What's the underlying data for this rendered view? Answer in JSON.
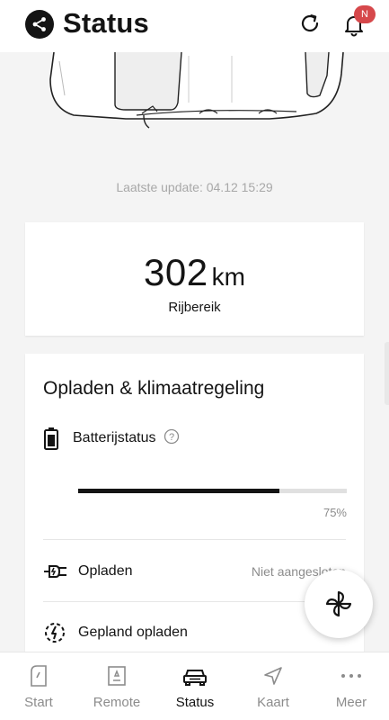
{
  "header": {
    "title": "Status",
    "notification_badge": "N"
  },
  "status": {
    "last_update": "Laatste update: 04.12 15:29",
    "range_value": "302",
    "range_unit": "km",
    "range_label": "Rijbereik"
  },
  "charging_card": {
    "title": "Opladen & klimaatregeling",
    "battery": {
      "label": "Batterijstatus",
      "percent": 75,
      "percent_text": "75%"
    },
    "rows": [
      {
        "label": "Opladen",
        "value": "Niet aangesloten",
        "icon": "plug-icon"
      },
      {
        "label": "Gepland opladen",
        "value": "",
        "icon": "scheduled-charge-icon"
      }
    ]
  },
  "fab": {
    "icon": "fan-icon"
  },
  "bottom_nav": {
    "items": [
      {
        "label": "Start",
        "icon": "home-icon"
      },
      {
        "label": "Remote",
        "icon": "remote-icon"
      },
      {
        "label": "Status",
        "icon": "car-icon",
        "active": true
      },
      {
        "label": "Kaart",
        "icon": "navigation-icon"
      },
      {
        "label": "Meer",
        "icon": "more-icon"
      }
    ]
  },
  "colors": {
    "accent_dark": "#141414",
    "badge": "#d6484b",
    "background": "#f4f4f4",
    "muted_text": "#8c8c8c"
  }
}
